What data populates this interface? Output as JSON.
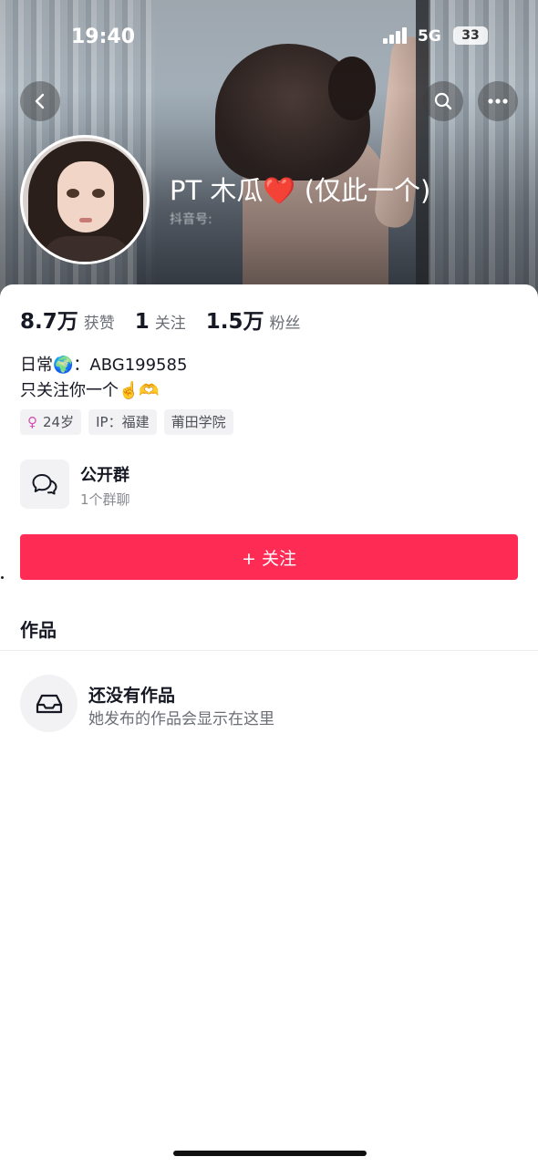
{
  "status_bar": {
    "time": "19:40",
    "network": "5G",
    "battery": "33"
  },
  "profile": {
    "name": "PT 木瓜❤️ (仅此一个)",
    "douyin_id_label": "抖音号:"
  },
  "stats": [
    {
      "value": "8.7万",
      "label": "获赞"
    },
    {
      "value": "1",
      "label": "关注"
    },
    {
      "value": "1.5万",
      "label": "粉丝"
    }
  ],
  "bio": {
    "line1": "日常🌍：ABG199585",
    "line2": "只关注你一个☝️🫶"
  },
  "tags": {
    "age": "24岁",
    "ip": "IP：福建",
    "school": "莆田学院"
  },
  "group": {
    "title": "公开群",
    "subtitle": "1个群聊"
  },
  "follow_button": {
    "label": "+ 关注"
  },
  "works": {
    "section_title": "作品",
    "empty_title": "还没有作品",
    "empty_subtitle": "她发布的作品会显示在这里"
  },
  "colors": {
    "accent": "#fe2c55",
    "female": "#d44fb5"
  }
}
